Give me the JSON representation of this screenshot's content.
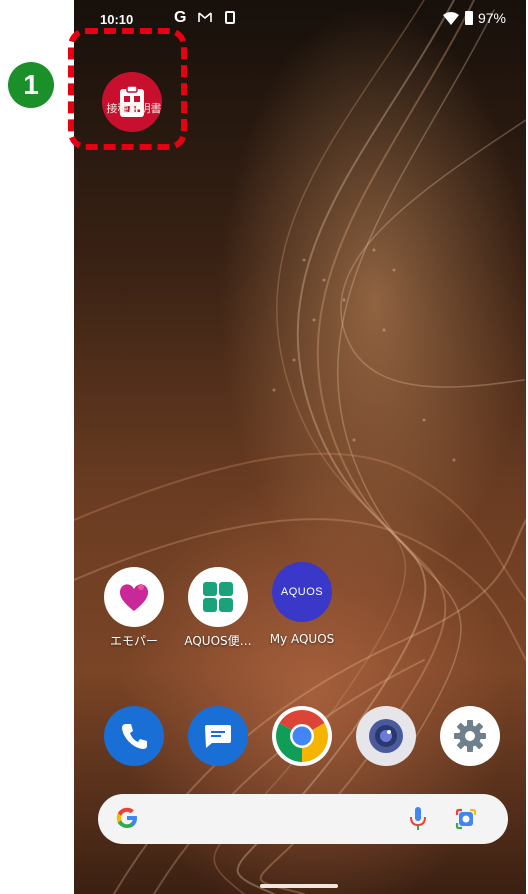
{
  "status_bar": {
    "time": "10:10",
    "g_label": "G",
    "battery": "97%"
  },
  "highlight": {
    "step_number": "1",
    "app_label": "接種証明書"
  },
  "apps": [
    {
      "label": "エモパー",
      "icon": "emopa-heart-icon"
    },
    {
      "label": "AQUOS便…",
      "icon": "aquos-grid-icon"
    },
    {
      "label": "My AQUOS",
      "icon": "my-aquos-icon",
      "logo_text": "AQUOS"
    }
  ],
  "dock": [
    {
      "icon": "phone-icon"
    },
    {
      "icon": "messages-icon"
    },
    {
      "icon": "chrome-icon"
    },
    {
      "icon": "camera-icon"
    },
    {
      "icon": "settings-gear-icon"
    }
  ],
  "search": {
    "google_icon": "google-g-icon",
    "mic_icon": "mic-icon",
    "lens_icon": "lens-icon"
  },
  "colors": {
    "highlight_red": "#e60012",
    "badge_green": "#1a8f2a",
    "app_red": "#c8102e",
    "aquos_blue": "#3a38c9"
  }
}
